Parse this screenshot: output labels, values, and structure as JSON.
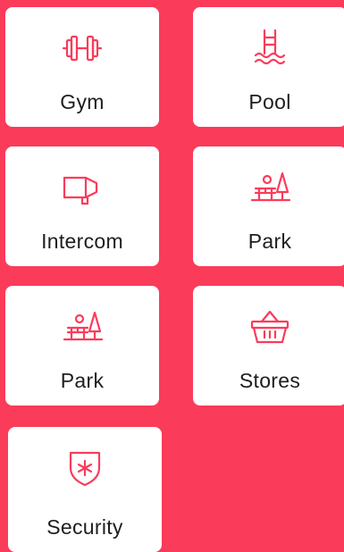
{
  "theme": {
    "background": "#fb3b5a",
    "tile_background": "#ffffff",
    "icon_color": "#fb3b5a",
    "label_color": "#1e1e1e"
  },
  "tiles": [
    {
      "label": "Gym",
      "icon": "dumbbell-icon"
    },
    {
      "label": "Pool",
      "icon": "pool-ladder-icon"
    },
    {
      "label": "Intercom",
      "icon": "megaphone-icon"
    },
    {
      "label": "Park",
      "icon": "park-bench-tree-icon"
    },
    {
      "label": "Park",
      "icon": "park-bench-tree-icon"
    },
    {
      "label": "Stores",
      "icon": "shopping-basket-icon"
    },
    {
      "label": "Security",
      "icon": "shield-star-icon"
    }
  ]
}
